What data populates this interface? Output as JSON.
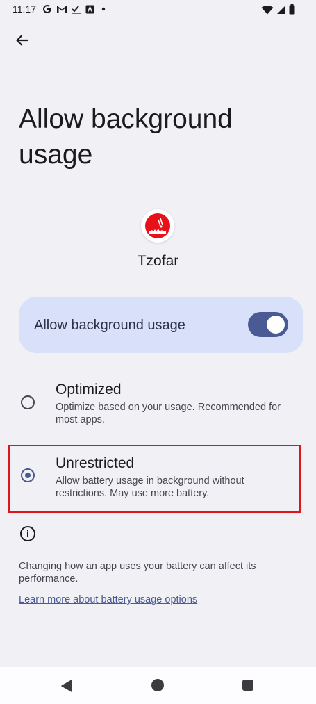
{
  "status_bar": {
    "time": "11:17",
    "left_icons": [
      "google-icon",
      "gmail-icon",
      "tasks-icon",
      "app-icon",
      "dot-icon"
    ],
    "right_icons": [
      "wifi-icon",
      "signal-icon",
      "battery-icon"
    ]
  },
  "page": {
    "title": "Allow background usage"
  },
  "app": {
    "name": "Tzofar",
    "icon": "tzofar-app-icon"
  },
  "toggle": {
    "label": "Allow background usage",
    "checked": true
  },
  "options": [
    {
      "title": "Optimized",
      "description": "Optimize based on your usage. Recommended for most apps.",
      "selected": false
    },
    {
      "title": "Unrestricted",
      "description": "Allow battery usage in background without restrictions. May use more battery.",
      "selected": true
    }
  ],
  "footer": {
    "text": "Changing how an app uses your battery can affect its performance.",
    "link": "Learn more about battery usage options"
  },
  "colors": {
    "background": "#f1f0f4",
    "accent": "#4a5a94",
    "card": "#d8e0fa",
    "highlight_border": "#e0141c"
  }
}
